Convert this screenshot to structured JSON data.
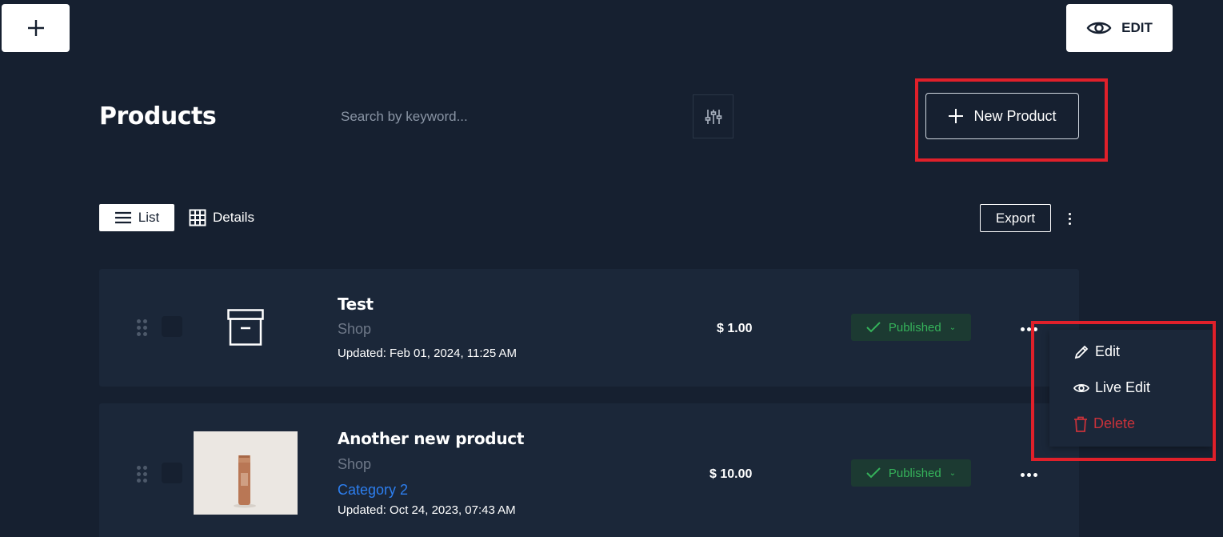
{
  "header": {
    "add_icon": "plus-icon",
    "edit_icon": "eye-icon",
    "edit_label": "EDIT"
  },
  "page": {
    "title": "Products"
  },
  "search": {
    "placeholder": "Search by keyword...",
    "filter_icon": "sliders-icon"
  },
  "toolbar": {
    "new_product_label": "New Product",
    "new_product_icon": "plus-icon"
  },
  "view": {
    "list_label": "List",
    "list_icon": "list-icon",
    "details_label": "Details",
    "details_icon": "grid-icon",
    "export_label": "Export",
    "more_icon": "vertical-dots-icon"
  },
  "products": [
    {
      "name": "Test",
      "shop": "Shop",
      "updated": "Updated: Feb 01, 2024, 11:25 AM",
      "price": "$ 1.00",
      "status": "Published",
      "image": "archive-icon"
    },
    {
      "name": "Another new product",
      "shop": "Shop",
      "category": "Category 2",
      "updated": "Updated: Oct 24, 2023, 07:43 AM",
      "price": "$ 10.00",
      "status": "Published",
      "image": "bottle-photo"
    }
  ],
  "context_menu": {
    "edit_label": "Edit",
    "edit_icon": "pencil-icon",
    "live_edit_label": "Live Edit",
    "live_edit_icon": "eye-icon",
    "delete_label": "Delete",
    "delete_icon": "trash-icon"
  },
  "colors": {
    "background": "#162030",
    "row": "#1b2739",
    "published": "#35b25a",
    "delete": "#c8323a",
    "highlight": "#e0202a",
    "link": "#2d7ff0"
  }
}
